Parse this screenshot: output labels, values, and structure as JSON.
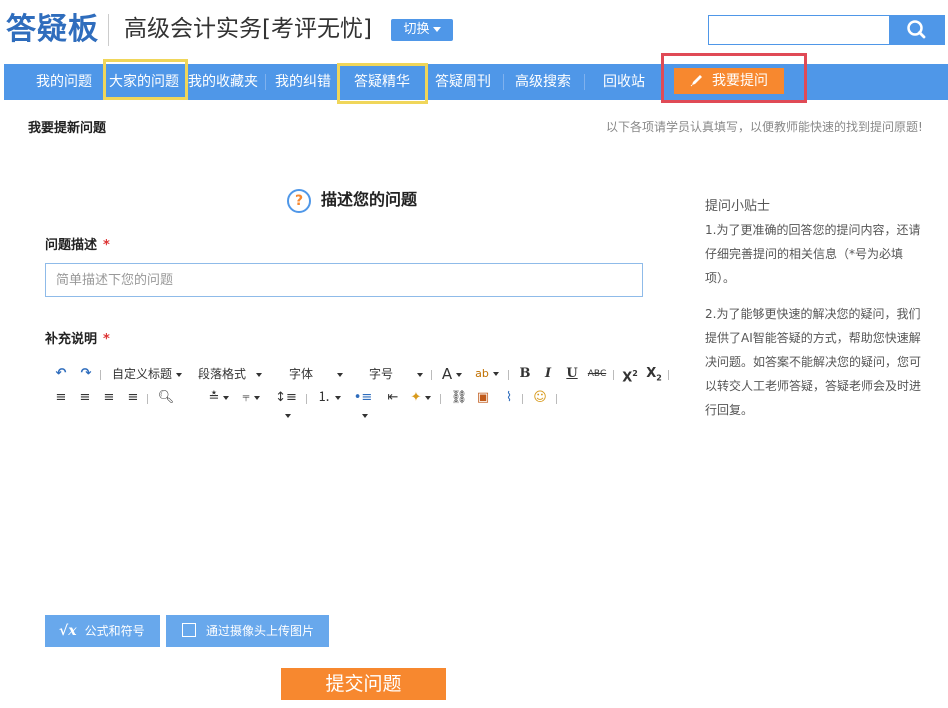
{
  "header": {
    "logo": "答疑板",
    "course": "高级会计实务[考评无忧]",
    "switch_label": "切换",
    "search_placeholder": ""
  },
  "nav": {
    "items": [
      "我的问题",
      "大家的问题",
      "我的收藏夹",
      "我的纠错",
      "答疑精华",
      "答疑周刊",
      "高级搜索",
      "回收站"
    ],
    "ask_label": "我要提问"
  },
  "subheader": {
    "title": "我要提新问题",
    "note": "以下各项请学员认真填写，以便教师能快速的找到提问原题!"
  },
  "form": {
    "section_title": "描述您的问题",
    "desc_label": "问题描述",
    "required_mark": "*",
    "desc_placeholder": "简单描述下您的问题",
    "supp_label": "补充说明"
  },
  "toolbar": {
    "custom_title": "自定义标题",
    "paragraph": "段落格式",
    "font": "字体",
    "font_size": "字号",
    "bold": "B",
    "italic": "I",
    "underline": "U",
    "strike": "ABC"
  },
  "tips": {
    "title": "提问小贴士",
    "p1": "1.为了更准确的回答您的提问内容，还请仔细完善提问的相关信息（*号为必填项）。",
    "p2": "2.为了能够更快速的解决您的疑问，我们提供了AI智能答疑的方式，帮助您快速解决问题。如答案不能解决您的疑问，您可以转交人工老师答疑，答疑老师会及时进行回复。"
  },
  "bottom": {
    "formula_label": "公式和符号",
    "camera_label": "通过摄像头上传图片",
    "submit_label": "提交问题"
  },
  "colors": {
    "accent": "#4f97e8",
    "orange": "#f7882f",
    "highlight_yellow": "#f0d65a",
    "highlight_red": "#e04a56"
  }
}
